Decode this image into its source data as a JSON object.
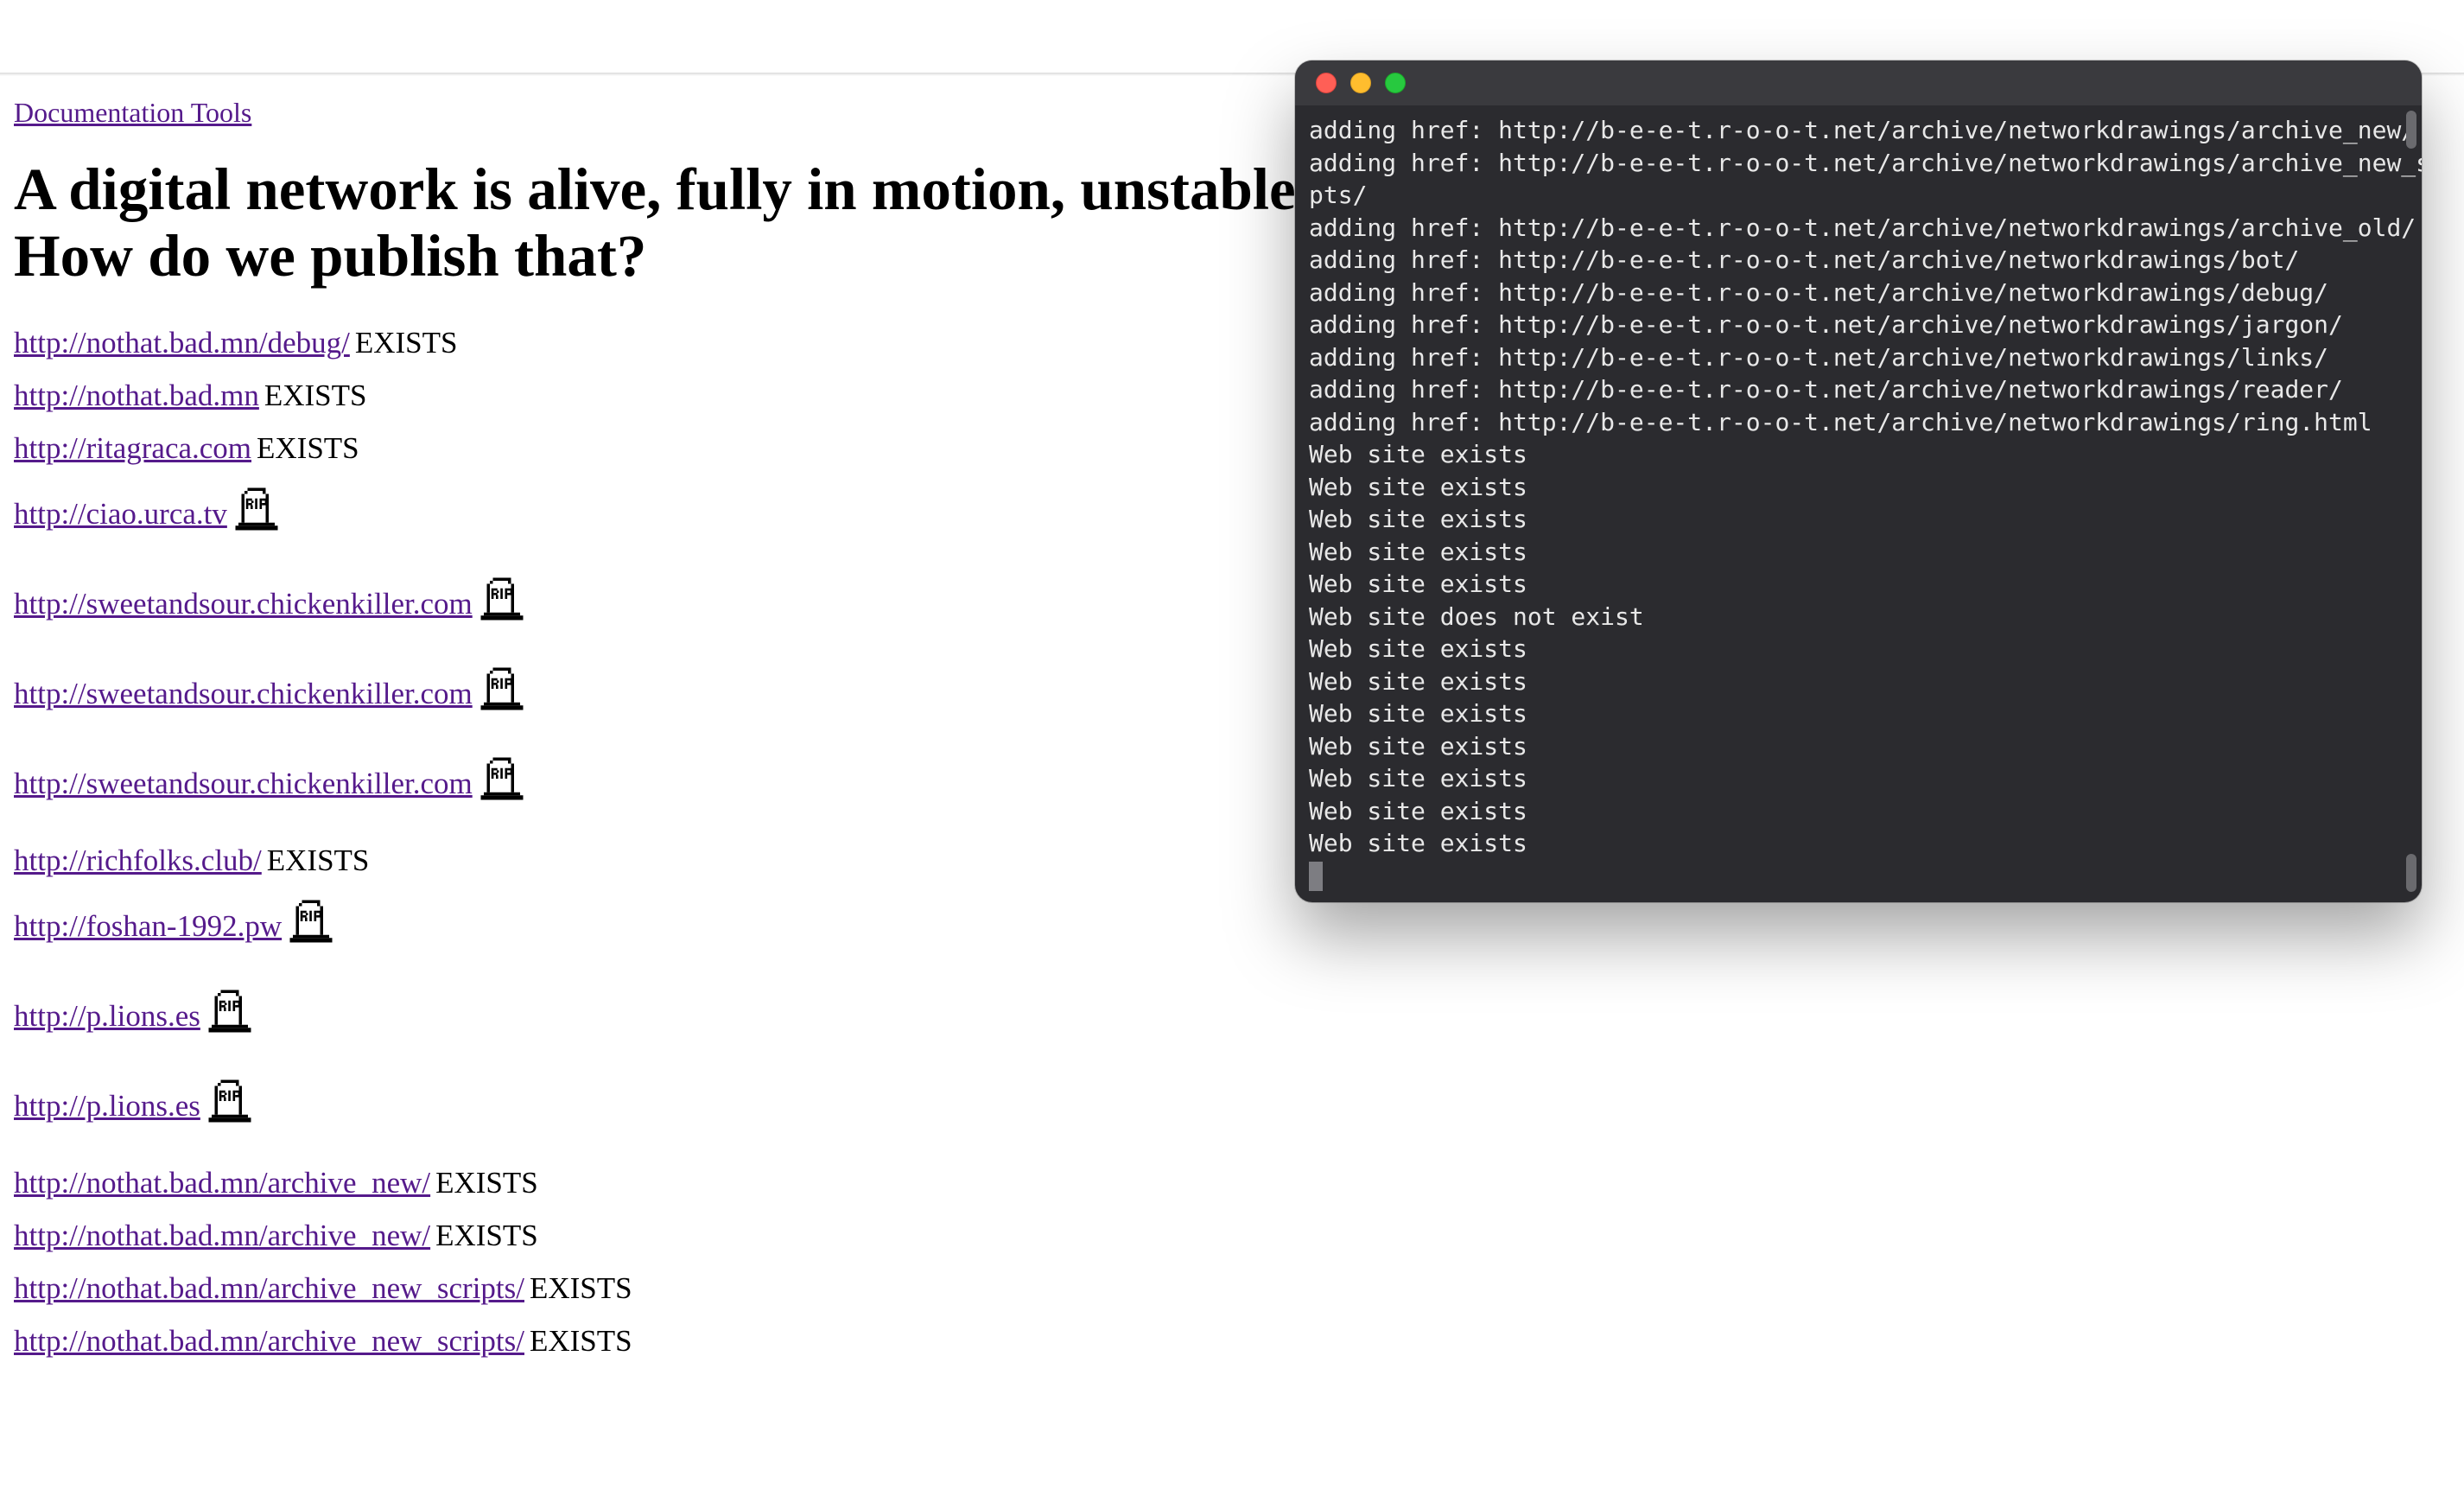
{
  "nav": {
    "label": "Documentation Tools"
  },
  "hero": {
    "line1": "A digital network is alive, fully in motion, unstable, ever-changing.",
    "line2": "How do we publish that?"
  },
  "existsLabel": "EXISTS",
  "links": [
    {
      "url": "http://nothat.bad.mn/debug/",
      "status": "exists"
    },
    {
      "url": "http://nothat.bad.mn",
      "status": "exists"
    },
    {
      "url": "http://ritagraca.com",
      "status": "exists"
    },
    {
      "url": "http://ciao.urca.tv",
      "status": "dead"
    },
    {
      "url": "http://sweetandsour.chickenkiller.com",
      "status": "dead"
    },
    {
      "url": "http://sweetandsour.chickenkiller.com",
      "status": "dead"
    },
    {
      "url": "http://sweetandsour.chickenkiller.com",
      "status": "dead"
    },
    {
      "url": "http://richfolks.club/",
      "status": "exists"
    },
    {
      "url": "http://foshan-1992.pw",
      "status": "dead"
    },
    {
      "url": "http://p.lions.es",
      "status": "dead"
    },
    {
      "url": "http://p.lions.es",
      "status": "dead"
    },
    {
      "url": "http://nothat.bad.mn/archive_new/",
      "status": "exists"
    },
    {
      "url": "http://nothat.bad.mn/archive_new/",
      "status": "exists"
    },
    {
      "url": "http://nothat.bad.mn/archive_new_scripts/",
      "status": "exists"
    },
    {
      "url": "http://nothat.bad.mn/archive_new_scripts/",
      "status": "exists"
    }
  ],
  "terminal": {
    "lines": [
      "adding href: http://b-e-e-t.r-o-o-t.net/archive/networkdrawings/archive_new/",
      "adding href: http://b-e-e-t.r-o-o-t.net/archive/networkdrawings/archive_new_scri",
      "pts/",
      "adding href: http://b-e-e-t.r-o-o-t.net/archive/networkdrawings/archive_old/",
      "adding href: http://b-e-e-t.r-o-o-t.net/archive/networkdrawings/bot/",
      "adding href: http://b-e-e-t.r-o-o-t.net/archive/networkdrawings/debug/",
      "adding href: http://b-e-e-t.r-o-o-t.net/archive/networkdrawings/jargon/",
      "adding href: http://b-e-e-t.r-o-o-t.net/archive/networkdrawings/links/",
      "adding href: http://b-e-e-t.r-o-o-t.net/archive/networkdrawings/reader/",
      "adding href: http://b-e-e-t.r-o-o-t.net/archive/networkdrawings/ring.html",
      "Web site exists",
      "Web site exists",
      "Web site exists",
      "Web site exists",
      "Web site exists",
      "Web site does not exist",
      "Web site exists",
      "Web site exists",
      "Web site exists",
      "Web site exists",
      "Web site exists",
      "Web site exists",
      "Web site exists"
    ]
  }
}
